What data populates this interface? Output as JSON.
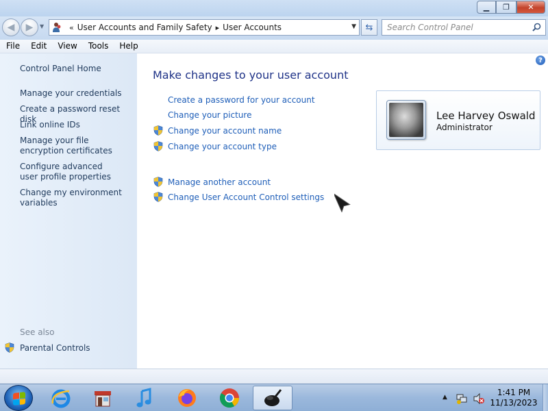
{
  "window": {
    "controls": {
      "minimize": "▁",
      "maximize": "❐",
      "close": "✕"
    }
  },
  "address_bar": {
    "overflow": "«",
    "breadcrumb": [
      "User Accounts and Family Safety",
      "User Accounts"
    ],
    "search_placeholder": "Search Control Panel"
  },
  "menu": [
    "File",
    "Edit",
    "View",
    "Tools",
    "Help"
  ],
  "sidebar": {
    "items": [
      "Control Panel Home",
      "Manage your credentials",
      "Create a password reset disk",
      "Link online IDs",
      "Manage your file encryption certificates",
      "Configure advanced user profile properties",
      "Change my environment variables"
    ],
    "see_also_label": "See also",
    "see_also_items": [
      "Parental Controls"
    ]
  },
  "main": {
    "title": "Make changes to your user account",
    "tasks": [
      {
        "label": "Create a password for your account",
        "shield": false
      },
      {
        "label": "Change your picture",
        "shield": false
      },
      {
        "label": "Change your account name",
        "shield": true
      },
      {
        "label": "Change your account type",
        "shield": true
      }
    ],
    "other_tasks": [
      {
        "label": "Manage another account",
        "shield": true
      },
      {
        "label": "Change User Account Control settings",
        "shield": true
      }
    ],
    "account": {
      "name": "Lee Harvey Oswald",
      "role": "Administrator"
    },
    "help_glyph": "?"
  },
  "taskbar": {
    "apps": [
      "internet-explorer",
      "store",
      "itunes",
      "firefox",
      "chrome",
      "active-app"
    ],
    "clock_time": "1:41 PM",
    "clock_date": "11/13/2023"
  },
  "colors": {
    "link": "#1e5eb8",
    "title": "#1e3287",
    "sidebar_bg": "#e4eef9",
    "taskbar": "#9bb8dc"
  }
}
